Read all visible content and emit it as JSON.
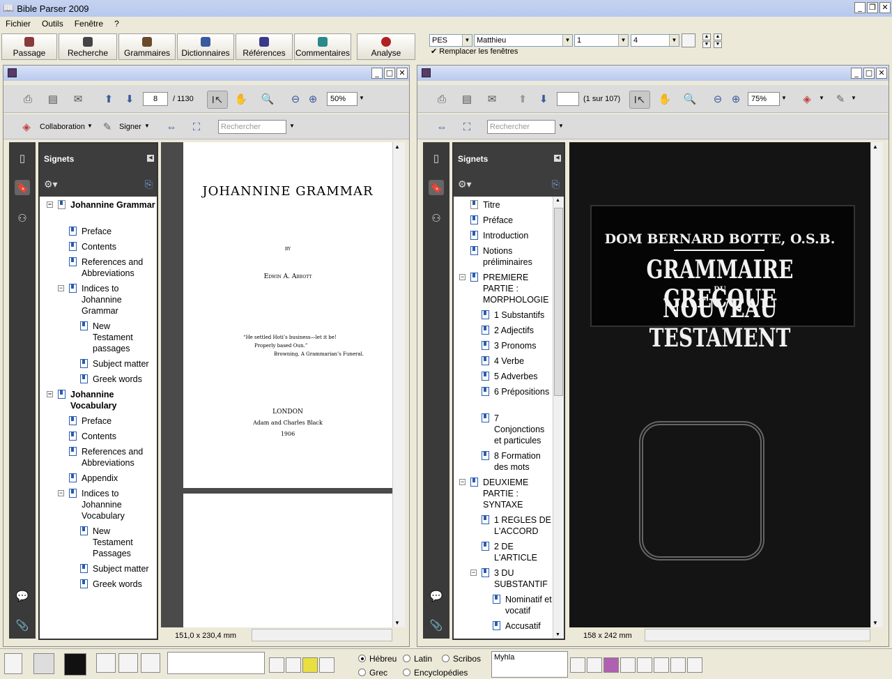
{
  "app": {
    "title": "Bible Parser 2009"
  },
  "menu": [
    "Fichier",
    "Outils",
    "Fenêtre",
    "?"
  ],
  "toolbar": {
    "buttons": [
      "Passage",
      "Recherche",
      "Grammaires",
      "Dictionnaires",
      "Références",
      "Commentaires",
      "Analyse"
    ],
    "version": "PES",
    "book": "Matthieu",
    "chapter": "1",
    "verse": "4",
    "replace_label": "Remplacer les fenêtres"
  },
  "left": {
    "page_current": "8",
    "page_total": "/ 1130",
    "zoom": "50%",
    "collaboration": "Collaboration",
    "signer": "Signer",
    "search_placeholder": "Rechercher",
    "bookmarks_title": "Signets",
    "bookmarks": [
      "Johannine Grammar",
      "Preface",
      "Contents",
      "References and Abbreviations",
      "Indices to Johannine Grammar",
      "New Testament passages",
      "Subject matter",
      "Greek words",
      "Johannine Vocabulary",
      "Preface",
      "Contents",
      "References and Abbreviations",
      "Appendix",
      "Indices to Johannine Vocabulary",
      "New Testament Passages",
      "Subject matter",
      "Greek words"
    ],
    "page_text": {
      "title": "JOHANNINE GRAMMAR",
      "by": "BY",
      "author": "Edwin A. Abbott",
      "quote1": "“He settled Hoti’s business—let it be!",
      "quote2": "Properly based Oun.”",
      "quote3": "Browning, A Grammarian’s Funeral.",
      "city": "LONDON",
      "publisher": "Adam and Charles Black",
      "year": "1906"
    },
    "page_size": "151,0 x 230,4 mm"
  },
  "right": {
    "page_info": "(1 sur 107)",
    "zoom": "75%",
    "search_placeholder": "Rechercher",
    "bookmarks_title": "Signets",
    "bookmarks": [
      "Titre",
      "Préface",
      "Introduction",
      "Notions préliminaires",
      "PREMIERE PARTIE : MORPHOLOGIE",
      "1 Substantifs",
      "2 Adjectifs",
      "3 Pronoms",
      "4 Verbe",
      "5 Adverbes",
      "6 Prépositions",
      "7 Conjonctions et particules",
      "8 Formation des mots",
      "DEUXIEME PARTIE : SYNTAXE",
      "1 REGLES DE L'ACCORD",
      "2 DE L'ARTICLE",
      "3 DU SUBSTANTIF",
      "Nominatif et vocatif",
      "Accusatif"
    ],
    "cover": {
      "author": "DOM BERNARD BOTTE, O.S.B.",
      "line1": "GRAMMAIRE GRECQUE",
      "du": "DU",
      "line2": "NOUVEAU TESTAMENT"
    },
    "page_size": "158 x 242 mm"
  },
  "bottom": {
    "radios": [
      "Hébreu",
      "Latin",
      "Scribos",
      "Grec",
      "Encyclopédies"
    ],
    "selected": "Hébreu",
    "text_field": "Myhla"
  }
}
